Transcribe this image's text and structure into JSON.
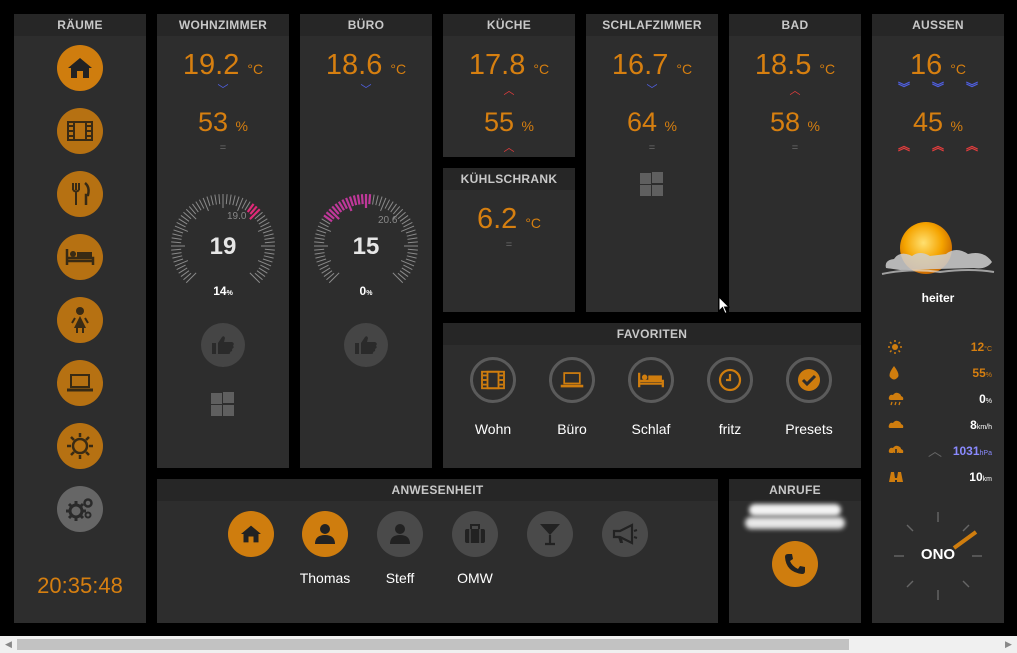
{
  "clock": "20:35:48",
  "rooms_header": "RÄUME",
  "rooms": {
    "wohnzimmer": {
      "title": "WOHNZIMMER",
      "temp": "19.2",
      "temp_unit": "°C",
      "hum": "53",
      "hum_unit": "%",
      "temp_trend": "down",
      "hum_trend": "equal",
      "gauge_value": "19",
      "gauge_setpoint": "19.0",
      "gauge_valve": "14",
      "gauge_valve_unit": "%"
    },
    "buero": {
      "title": "BÜRO",
      "temp": "18.6",
      "temp_unit": "°C",
      "temp_trend": "down",
      "gauge_value": "15",
      "gauge_setpoint": "20.6",
      "gauge_valve": "0",
      "gauge_valve_unit": "%"
    },
    "kueche": {
      "title": "KÜCHE",
      "temp": "17.8",
      "temp_unit": "°C",
      "hum": "55",
      "hum_unit": "%",
      "temp_trend": "up",
      "hum_trend": "up"
    },
    "kuehlschrank": {
      "title": "KÜHLSCHRANK",
      "temp": "6.2",
      "temp_unit": "°C",
      "temp_trend": "equal"
    },
    "schlafzimmer": {
      "title": "SCHLAFZIMMER",
      "temp": "16.7",
      "temp_unit": "°C",
      "hum": "64",
      "hum_unit": "%",
      "temp_trend": "down",
      "hum_trend": "equal"
    },
    "bad": {
      "title": "BAD",
      "temp": "18.5",
      "temp_unit": "°C",
      "hum": "58",
      "hum_unit": "%",
      "temp_trend": "up",
      "hum_trend": "equal"
    }
  },
  "aussen": {
    "title": "AUSSEN",
    "temp": "16",
    "temp_unit": "°C",
    "hum": "45",
    "hum_unit": "%",
    "condition": "heiter",
    "rows": [
      {
        "icon": "sun-icon",
        "value": "12",
        "unit": "°C"
      },
      {
        "icon": "drop-icon",
        "value": "55",
        "unit": "%"
      },
      {
        "icon": "rain-icon",
        "value": "0",
        "unit": "%"
      },
      {
        "icon": "wind-icon",
        "value": "8",
        "unit": "km/h"
      },
      {
        "icon": "pressure-icon",
        "value": "1031",
        "unit": "hPa"
      },
      {
        "icon": "binoculars-icon",
        "value": "10",
        "unit": "km"
      }
    ],
    "compass": "ONO"
  },
  "favoriten": {
    "title": "FAVORITEN",
    "items": [
      {
        "label": "Wohn",
        "icon": "film-icon"
      },
      {
        "label": "Büro",
        "icon": "laptop-icon"
      },
      {
        "label": "Schlaf",
        "icon": "bed-icon"
      },
      {
        "label": "fritz",
        "icon": "clock-icon"
      },
      {
        "label": "Presets",
        "icon": "check-icon"
      }
    ]
  },
  "anwesenheit": {
    "title": "ANWESENHEIT",
    "items": [
      {
        "label": "",
        "icon": "home-icon",
        "active": true
      },
      {
        "label": "Thomas",
        "icon": "person-icon",
        "active": true
      },
      {
        "label": "Steff",
        "icon": "person-icon",
        "active": false
      },
      {
        "label": "OMW",
        "icon": "suitcase-icon",
        "active": false
      },
      {
        "label": "",
        "icon": "cocktail-icon",
        "active": false
      },
      {
        "label": "",
        "icon": "megaphone-icon",
        "active": false
      }
    ]
  },
  "anrufe": {
    "title": "ANRUFE"
  },
  "colors": {
    "accent": "#cf7d0e",
    "panel": "#2d2d2d",
    "trend_down": "#4f5fe0",
    "trend_up": "#e23d3d"
  }
}
